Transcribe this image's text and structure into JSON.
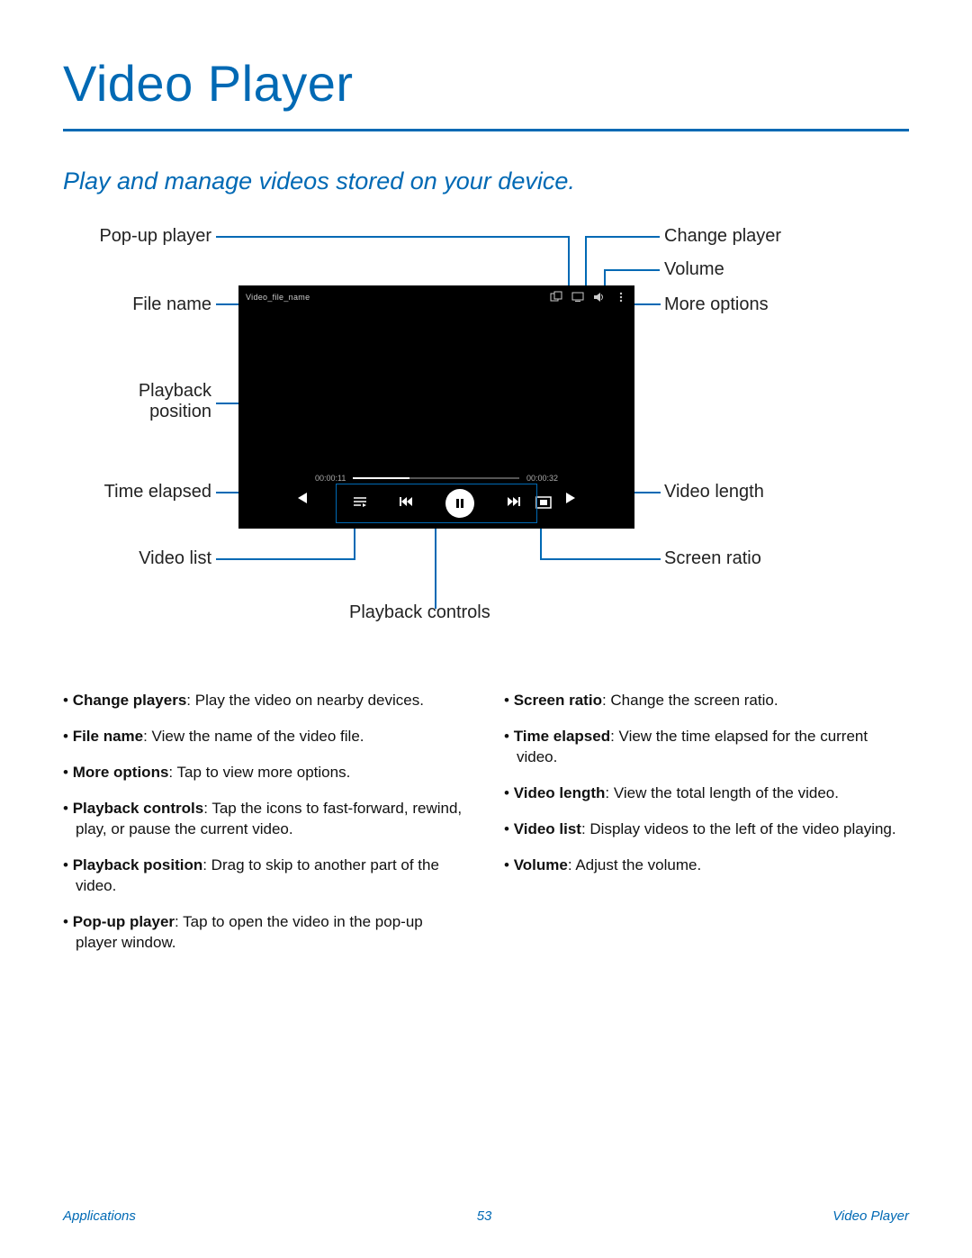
{
  "title": "Video Player",
  "subtitle": "Play and manage videos stored on your device.",
  "labels": {
    "popup": "Pop-up player",
    "filename": "File name",
    "playback_pos_l1": "Playback",
    "playback_pos_l2": "position",
    "time_elapsed": "Time elapsed",
    "video_list": "Video list",
    "playback_controls": "Playback controls",
    "change_player": "Change player",
    "volume": "Volume",
    "more_options": "More options",
    "video_length": "Video length",
    "screen_ratio": "Screen ratio"
  },
  "player": {
    "filename": "Video_file_name",
    "elapsed": "00:00:11",
    "length": "00:00:32"
  },
  "bullets_left": [
    {
      "b": "Change players",
      "t": ": Play the video on nearby devices."
    },
    {
      "b": "File name",
      "t": ": View the name of the video file."
    },
    {
      "b": "More options",
      "t": ": Tap to view more options."
    },
    {
      "b": "Playback controls",
      "t": ": Tap the icons to fast-forward, rewind, play, or pause the current video."
    },
    {
      "b": "Playback position",
      "t": ": Drag to skip to another part of the video."
    },
    {
      "b": "Pop-up player",
      "t": ": Tap to open the video in the pop-up player window."
    }
  ],
  "bullets_right": [
    {
      "b": "Screen ratio",
      "t": ": Change the screen ratio."
    },
    {
      "b": "Time elapsed",
      "t": ": View the time elapsed for the current video."
    },
    {
      "b": "Video length",
      "t": ": View the total length of the video."
    },
    {
      "b": "Video list",
      "t": ": Display videos to the left of the video playing."
    },
    {
      "b": "Volume",
      "t": ": Adjust the volume."
    }
  ],
  "footer": {
    "left": "Applications",
    "center": "53",
    "right": "Video Player"
  }
}
